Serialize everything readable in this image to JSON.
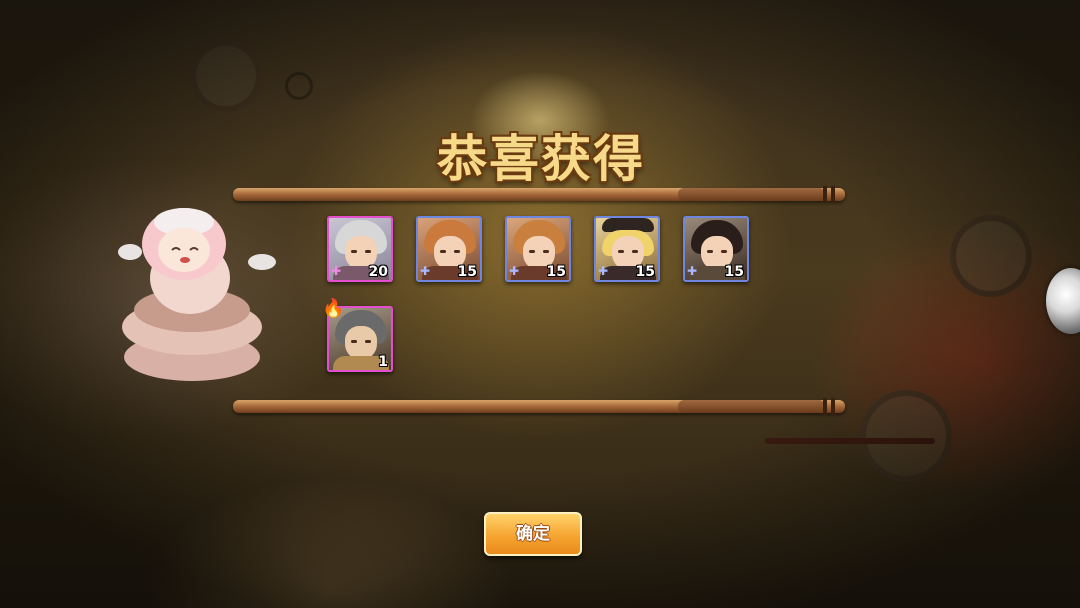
{
  "title": "恭喜获得",
  "rewards": [
    {
      "count": "20",
      "rarity": "pink",
      "hair": "#cfcfcf",
      "cloth": "#7a5a6a"
    },
    {
      "count": "15",
      "rarity": "blue",
      "hair": "#c97a3c",
      "cloth": "#6a3a2a"
    },
    {
      "count": "15",
      "rarity": "blue",
      "hair": "#c9803e",
      "cloth": "#6a3a2a"
    },
    {
      "count": "15",
      "rarity": "blue",
      "hair": "#f0d36a",
      "cloth": "#3a2a2a"
    },
    {
      "count": "15",
      "rarity": "blue",
      "hair": "#2a1e1a",
      "cloth": "#5a4a3a"
    },
    {
      "count": "1",
      "rarity": "pink",
      "hair": "#6a6a6a",
      "cloth": "#b08a50"
    }
  ],
  "confirm_label": "确定",
  "icons": {
    "puzzle": "puzzle-piece-icon",
    "fire": "fire-icon"
  },
  "colors": {
    "pink_frame": "#e44fd0",
    "blue_frame": "#6e86e0",
    "button_orange": "#f6a531",
    "title_gold": "#f7d98a"
  }
}
